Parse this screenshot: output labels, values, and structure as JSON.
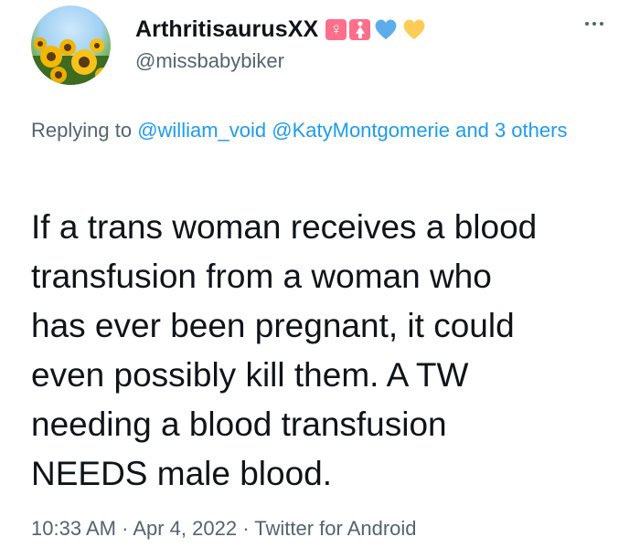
{
  "user": {
    "display_name": "ArthritisaurusXX",
    "handle": "@missbabybiker",
    "emojis": [
      {
        "icon": "female-sign-icon",
        "glyph": "♀",
        "color": "#ff6e8a"
      },
      {
        "icon": "woman-figure-icon",
        "glyph": "🚺",
        "color": "#ff6e8a"
      },
      {
        "icon": "blue-heart-icon",
        "color": "#5dadec"
      },
      {
        "icon": "yellow-heart-icon",
        "color": "#fdcb58"
      }
    ]
  },
  "reply": {
    "prefix": "Replying to",
    "mentions": [
      "@william_void",
      "@KatyMontgomerie"
    ],
    "suffix_link": "and 3 others"
  },
  "tweet": {
    "lines": [
      "If a trans woman receives a blood",
      "transfusion from a woman who",
      "has ever been pregnant, it could",
      "even possibly kill them. A TW",
      "needing a blood transfusion",
      "NEEDS male blood."
    ]
  },
  "meta": {
    "time": "10:33 AM",
    "date": "Apr 4, 2022",
    "source": "Twitter for Android",
    "separator": "·"
  },
  "colors": {
    "text": "#0f1419",
    "secondary": "#536471",
    "link": "#1d9bf0"
  }
}
